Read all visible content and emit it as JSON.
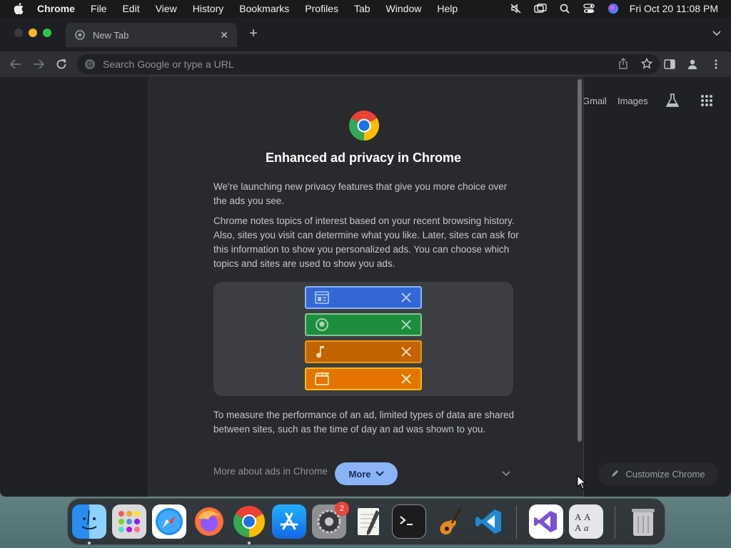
{
  "menubar": {
    "app_name": "Chrome",
    "items": [
      "File",
      "Edit",
      "View",
      "History",
      "Bookmarks",
      "Profiles",
      "Tab",
      "Window",
      "Help"
    ],
    "clock": "Fri Oct 20  11:08 PM",
    "status_icons": [
      "mute-icon",
      "screen-mirror-icon",
      "spotlight-search-icon",
      "control-center-icon",
      "siri-icon"
    ]
  },
  "browser": {
    "tab_title": "New Tab",
    "omnibox_placeholder": "Search Google or type a URL"
  },
  "ntp": {
    "gmail_label": "Gmail",
    "images_label": "Images",
    "customize_label": "Customize Chrome"
  },
  "dialog": {
    "title": "Enhanced ad privacy in Chrome",
    "para1": "We're launching new privacy features that give you more choice over the ads you see.",
    "para2": "Chrome notes topics of interest based on your recent browsing history. Also, sites you visit can determine what you like. Later, sites can ask for this information to show you personalized ads. You can choose which topics and sites are used to show you ads.",
    "para3": "To measure the performance of an ad, limited types of data are shared between sites, such as the time of day an ad was shown to you.",
    "more_about": "More about ads in Chrome",
    "more_button": "More",
    "topics": [
      {
        "icon": "news-icon",
        "color": "#3367d6"
      },
      {
        "icon": "sports-ball-icon",
        "color": "#1e8e3e"
      },
      {
        "icon": "music-note-icon",
        "color": "#c26401"
      },
      {
        "icon": "movie-clapper-icon",
        "color": "#e37400"
      }
    ]
  },
  "dock": {
    "apps": [
      "Finder",
      "Launchpad",
      "Safari",
      "Firefox",
      "Chrome",
      "App Store",
      "System Settings",
      "TextEdit",
      "Terminal",
      "GarageBand",
      "Visual Studio Code",
      "Visual Studio",
      "Dictionary",
      "Trash"
    ],
    "settings_badge": "2"
  }
}
